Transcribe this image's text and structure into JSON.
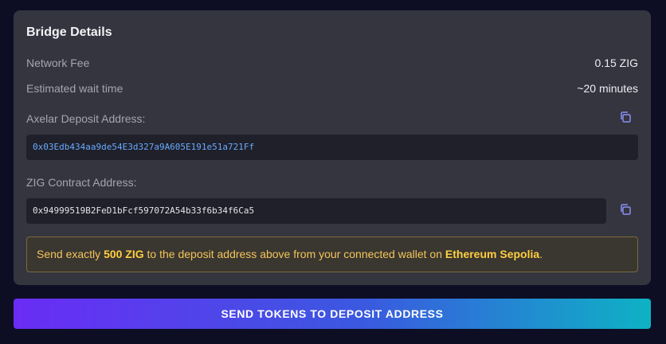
{
  "card": {
    "title": "Bridge Details",
    "fee": {
      "label": "Network Fee",
      "value": "0.15 ZIG"
    },
    "wait": {
      "label": "Estimated wait time",
      "value": "~20 minutes"
    },
    "axelar": {
      "label": "Axelar Deposit Address:",
      "address": "0x03Edb434aa9de54E3d327a9A605E191e51a721Ff"
    },
    "zig_contract": {
      "label": "ZIG Contract Address:",
      "address": "0x94999519B2FeD1bFcf597072A54b33f6b34f6Ca5"
    },
    "notice": {
      "prefix": "Send exactly ",
      "amount": "500 ZIG",
      "middle": " to the deposit address above from your connected wallet on ",
      "network": "Ethereum Sepolia",
      "suffix": "."
    }
  },
  "send_button": {
    "label": "SEND TOKENS TO DEPOSIT ADDRESS"
  },
  "icons": {
    "copy": "copy-icon"
  },
  "colors": {
    "icon": "#8b8ff5",
    "accent_yellow": "#ffcf3f",
    "address_blue": "#6aa9ff"
  }
}
